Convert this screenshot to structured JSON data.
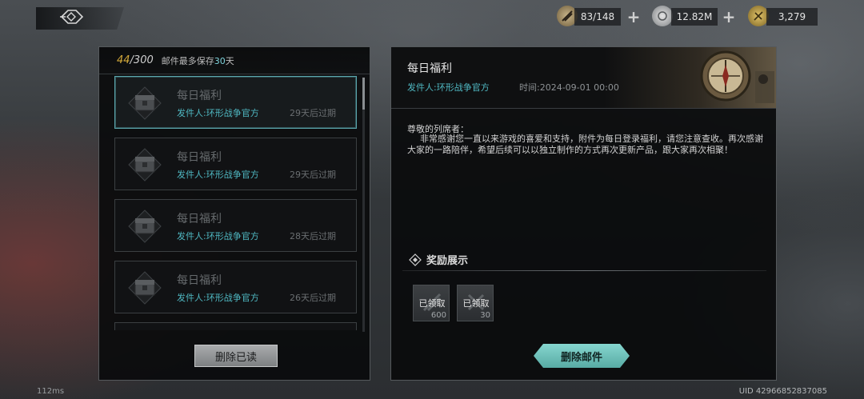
{
  "top_bar": {
    "back_icon": "back-emblem-icon",
    "resources": [
      {
        "icon": "stamina-icon",
        "value": "83/148",
        "plus": "+"
      },
      {
        "icon": "silver-coin-icon",
        "value": "12.82M",
        "plus": "+"
      },
      {
        "icon": "gold-coin-icon",
        "value": "3,279"
      }
    ]
  },
  "mail_list": {
    "count_current": "44",
    "count_max": "/300",
    "note_prefix": "邮件最多保存",
    "note_number": "30",
    "note_suffix": "天",
    "items": [
      {
        "title": "每日福利",
        "sender": "发件人:环形战争官方",
        "expire": "29天后过期",
        "selected": true
      },
      {
        "title": "每日福利",
        "sender": "发件人:环形战争官方",
        "expire": "29天后过期",
        "selected": false
      },
      {
        "title": "每日福利",
        "sender": "发件人:环形战争官方",
        "expire": "28天后过期",
        "selected": false
      },
      {
        "title": "每日福利",
        "sender": "发件人:环形战争官方",
        "expire": "26天后过期",
        "selected": false
      }
    ],
    "delete_read_label": "删除已读"
  },
  "mail_detail": {
    "title": "每日福利",
    "sender": "发件人:环形战争官方",
    "time": "时间:2024-09-01 00:00",
    "greeting": "尊敬的列席者：",
    "body": "非常感谢您一直以来游戏的喜爱和支持，附件为每日登录福利，请您注意查收。再次感谢大家的一路陪伴，希望后续可以以独立制作的方式再次更新产品，跟大家再次相聚！",
    "reward_label": "奖励展示",
    "rewards": [
      {
        "status": "已领取",
        "qty": "600"
      },
      {
        "status": "已领取",
        "qty": "30"
      }
    ],
    "delete_label": "删除邮件"
  },
  "footer": {
    "latency": "112ms",
    "uid": "UID 42966852837085"
  },
  "colors": {
    "accent_teal": "#4fb8c2",
    "count_gold": "#d2a83a",
    "delete_button": "#6fc3bc"
  }
}
